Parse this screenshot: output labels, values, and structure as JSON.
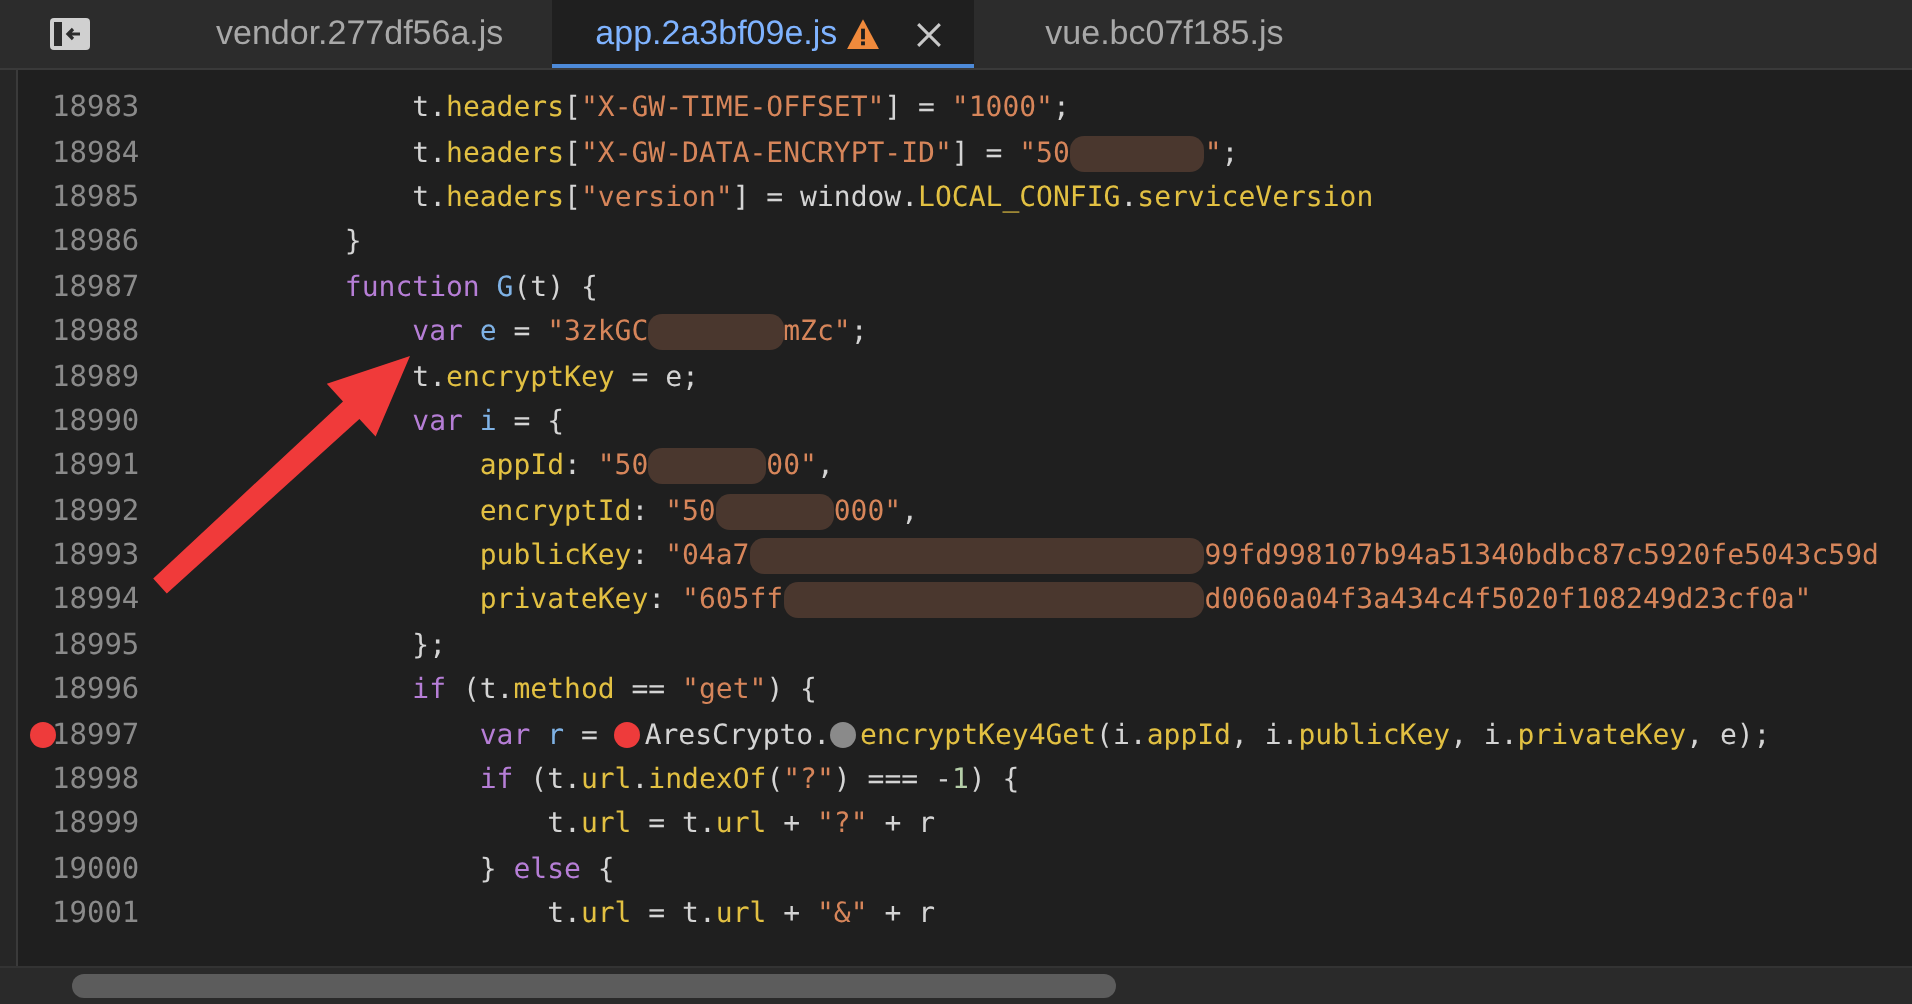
{
  "tabs": [
    {
      "label": "vendor.277df56a.js",
      "selected": false,
      "warning": false,
      "closable": false
    },
    {
      "label": "app.2a3bf09e.js",
      "selected": true,
      "warning": true,
      "closable": true
    },
    {
      "label": "vue.bc07f185.js",
      "selected": false,
      "warning": false,
      "closable": false
    }
  ],
  "lines": [
    {
      "number": "18983",
      "breakpoint": false,
      "tokens": [
        {
          "kind": "plain",
          "text": "            t."
        },
        {
          "kind": "prop",
          "text": "headers"
        },
        {
          "kind": "plain",
          "text": "["
        },
        {
          "kind": "string",
          "text": "\"X-GW-TIME-OFFSET\""
        },
        {
          "kind": "plain",
          "text": "] = "
        },
        {
          "kind": "string",
          "text": "\"1000\""
        },
        {
          "kind": "plain",
          "text": ";"
        }
      ]
    },
    {
      "number": "18984",
      "breakpoint": false,
      "tokens": [
        {
          "kind": "plain",
          "text": "            t."
        },
        {
          "kind": "prop",
          "text": "headers"
        },
        {
          "kind": "plain",
          "text": "["
        },
        {
          "kind": "string",
          "text": "\"X-GW-DATA-ENCRYPT-ID\""
        },
        {
          "kind": "plain",
          "text": "] = "
        },
        {
          "kind": "string",
          "text": "\"50"
        },
        {
          "kind": "redacted"
        },
        {
          "kind": "string",
          "text": "\""
        },
        {
          "kind": "plain",
          "text": ";"
        }
      ]
    },
    {
      "number": "18985",
      "breakpoint": false,
      "tokens": [
        {
          "kind": "plain",
          "text": "            t."
        },
        {
          "kind": "prop",
          "text": "headers"
        },
        {
          "kind": "plain",
          "text": "["
        },
        {
          "kind": "string",
          "text": "\"version\""
        },
        {
          "kind": "plain",
          "text": "] = window."
        },
        {
          "kind": "prop",
          "text": "LOCAL_CONFIG"
        },
        {
          "kind": "plain",
          "text": "."
        },
        {
          "kind": "prop",
          "text": "serviceVersion"
        }
      ]
    },
    {
      "number": "18986",
      "breakpoint": false,
      "tokens": [
        {
          "kind": "plain",
          "text": "        }"
        }
      ]
    },
    {
      "number": "18987",
      "breakpoint": false,
      "tokens": [
        {
          "kind": "keyword",
          "text": "        function "
        },
        {
          "kind": "name",
          "text": "G"
        },
        {
          "kind": "plain",
          "text": "(t) {"
        }
      ]
    },
    {
      "number": "18988",
      "breakpoint": false,
      "tokens": [
        {
          "kind": "keyword",
          "text": "            var "
        },
        {
          "kind": "name",
          "text": "e"
        },
        {
          "kind": "plain",
          "text": " = "
        },
        {
          "kind": "string",
          "text": "\"3zkGC"
        },
        {
          "kind": "redacted"
        },
        {
          "kind": "string",
          "text": "mZc\""
        },
        {
          "kind": "plain",
          "text": ";"
        }
      ]
    },
    {
      "number": "18989",
      "breakpoint": false,
      "tokens": [
        {
          "kind": "plain",
          "text": "            t."
        },
        {
          "kind": "prop",
          "text": "encryptKey"
        },
        {
          "kind": "plain",
          "text": " = e;"
        }
      ]
    },
    {
      "number": "18990",
      "breakpoint": false,
      "tokens": [
        {
          "kind": "keyword",
          "text": "            var "
        },
        {
          "kind": "name",
          "text": "i"
        },
        {
          "kind": "plain",
          "text": " = {"
        }
      ]
    },
    {
      "number": "18991",
      "breakpoint": false,
      "tokens": [
        {
          "kind": "prop",
          "text": "                appId"
        },
        {
          "kind": "plain",
          "text": ": "
        },
        {
          "kind": "string",
          "text": "\"50"
        },
        {
          "kind": "redacted"
        },
        {
          "kind": "string",
          "text": "00\""
        },
        {
          "kind": "plain",
          "text": ","
        }
      ]
    },
    {
      "number": "18992",
      "breakpoint": false,
      "tokens": [
        {
          "kind": "prop",
          "text": "                encryptId"
        },
        {
          "kind": "plain",
          "text": ": "
        },
        {
          "kind": "string",
          "text": "\"50"
        },
        {
          "kind": "redacted"
        },
        {
          "kind": "string",
          "text": "000\""
        },
        {
          "kind": "plain",
          "text": ","
        }
      ]
    },
    {
      "number": "18993",
      "breakpoint": false,
      "tokens": [
        {
          "kind": "prop",
          "text": "                publicKey"
        },
        {
          "kind": "plain",
          "text": ": "
        },
        {
          "kind": "string",
          "text": "\"04a7"
        },
        {
          "kind": "redacted"
        },
        {
          "kind": "string",
          "text": "99fd998107b94a51340bdbc87c5920fe5043c59d"
        }
      ]
    },
    {
      "number": "18994",
      "breakpoint": false,
      "tokens": [
        {
          "kind": "prop",
          "text": "                privateKey"
        },
        {
          "kind": "plain",
          "text": ": "
        },
        {
          "kind": "string",
          "text": "\"605ff"
        },
        {
          "kind": "redacted"
        },
        {
          "kind": "string",
          "text": "d0060a04f3a434c4f5020f108249d23cf0a\""
        }
      ]
    },
    {
      "number": "18995",
      "breakpoint": false,
      "tokens": [
        {
          "kind": "plain",
          "text": "            };"
        }
      ]
    },
    {
      "number": "18996",
      "breakpoint": false,
      "tokens": [
        {
          "kind": "keyword",
          "text": "            if"
        },
        {
          "kind": "plain",
          "text": " (t."
        },
        {
          "kind": "prop",
          "text": "method"
        },
        {
          "kind": "plain",
          "text": " == "
        },
        {
          "kind": "string",
          "text": "\"get\""
        },
        {
          "kind": "plain",
          "text": ") {"
        }
      ]
    },
    {
      "number": "18997",
      "breakpoint": true,
      "tokens": [
        {
          "kind": "keyword",
          "text": "                var "
        },
        {
          "kind": "name",
          "text": "r"
        },
        {
          "kind": "plain",
          "text": " = "
        },
        {
          "kind": "inline-breakpoint",
          "enabled": true
        },
        {
          "kind": "plain",
          "text": "AresCrypto."
        },
        {
          "kind": "inline-breakpoint",
          "enabled": false
        },
        {
          "kind": "prop",
          "text": "encryptKey4Get"
        },
        {
          "kind": "plain",
          "text": "(i."
        },
        {
          "kind": "prop",
          "text": "appId"
        },
        {
          "kind": "plain",
          "text": ", i."
        },
        {
          "kind": "prop",
          "text": "publicKey"
        },
        {
          "kind": "plain",
          "text": ", i."
        },
        {
          "kind": "prop",
          "text": "privateKey"
        },
        {
          "kind": "plain",
          "text": ", e);"
        }
      ]
    },
    {
      "number": "18998",
      "breakpoint": false,
      "tokens": [
        {
          "kind": "keyword",
          "text": "                if"
        },
        {
          "kind": "plain",
          "text": " (t."
        },
        {
          "kind": "prop",
          "text": "url"
        },
        {
          "kind": "plain",
          "text": "."
        },
        {
          "kind": "prop",
          "text": "indexOf"
        },
        {
          "kind": "plain",
          "text": "("
        },
        {
          "kind": "string",
          "text": "\"?\""
        },
        {
          "kind": "plain",
          "text": ") === -"
        },
        {
          "kind": "number",
          "text": "1"
        },
        {
          "kind": "plain",
          "text": ") {"
        }
      ]
    },
    {
      "number": "18999",
      "breakpoint": false,
      "tokens": [
        {
          "kind": "plain",
          "text": "                    t."
        },
        {
          "kind": "prop",
          "text": "url"
        },
        {
          "kind": "plain",
          "text": " = t."
        },
        {
          "kind": "prop",
          "text": "url"
        },
        {
          "kind": "plain",
          "text": " + "
        },
        {
          "kind": "string",
          "text": "\"?\""
        },
        {
          "kind": "plain",
          "text": " + r"
        }
      ]
    },
    {
      "number": "19000",
      "breakpoint": false,
      "tokens": [
        {
          "kind": "plain",
          "text": "                } "
        },
        {
          "kind": "keyword",
          "text": "else"
        },
        {
          "kind": "plain",
          "text": " {"
        }
      ]
    },
    {
      "number": "19001",
      "breakpoint": false,
      "tokens": [
        {
          "kind": "plain",
          "text": "                    t."
        },
        {
          "kind": "prop",
          "text": "url"
        },
        {
          "kind": "plain",
          "text": " = t."
        },
        {
          "kind": "prop",
          "text": "url"
        },
        {
          "kind": "plain",
          "text": " + "
        },
        {
          "kind": "string",
          "text": "\"&\""
        },
        {
          "kind": "plain",
          "text": " + r"
        }
      ]
    }
  ]
}
